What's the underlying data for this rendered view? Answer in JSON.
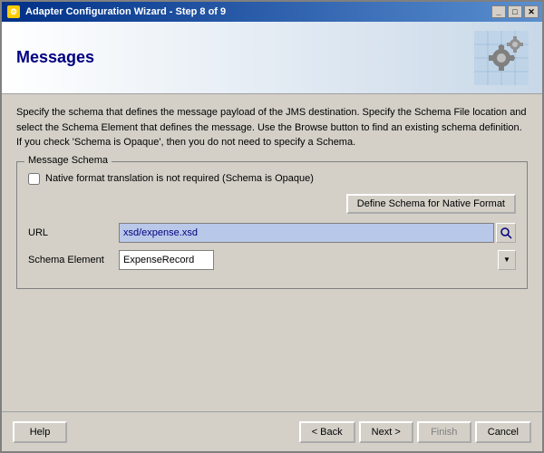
{
  "window": {
    "title": "Adapter Configuration Wizard - Step 8 of 9",
    "close_label": "✕"
  },
  "header": {
    "title": "Messages"
  },
  "description": "Specify the schema that defines the message payload of the JMS destination.  Specify the Schema File location and select the Schema Element that defines the message. Use the Browse button to find an existing schema definition. If you check 'Schema is Opaque', then you do not need to specify a Schema.",
  "group_box": {
    "legend": "Message Schema",
    "checkbox_label": "Native format translation is not required (Schema is Opaque)",
    "define_schema_btn": "Define Schema for Native Format",
    "url_label": "URL",
    "url_value": "xsd/expense.xsd",
    "schema_element_label": "Schema Element",
    "schema_element_value": "ExpenseRecord"
  },
  "footer": {
    "help_label": "Help",
    "back_label": "< Back",
    "next_label": "Next >",
    "finish_label": "Finish",
    "cancel_label": "Cancel"
  }
}
